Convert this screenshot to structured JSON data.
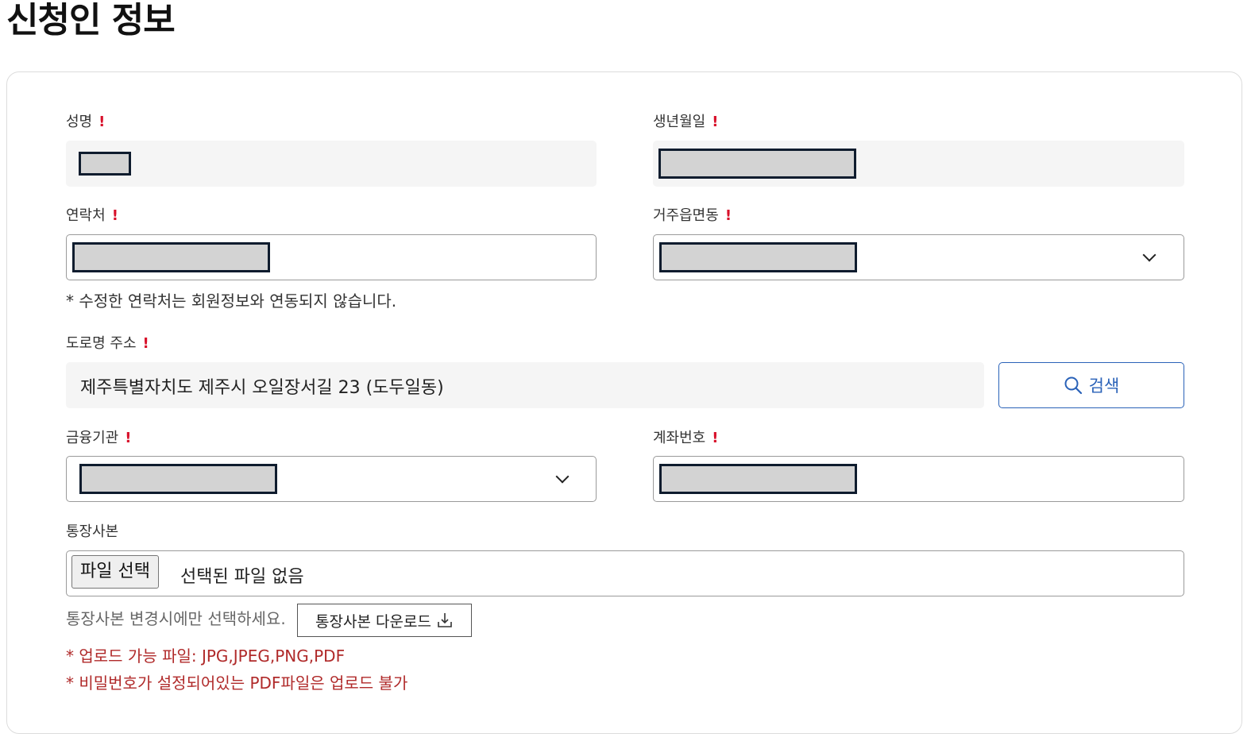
{
  "page": {
    "title": "신청인 정보"
  },
  "form": {
    "name": {
      "label": "성명",
      "required_mark": "!"
    },
    "birthdate": {
      "label": "생년월일",
      "required_mark": "!"
    },
    "contact": {
      "label": "연락처",
      "required_mark": "!",
      "note": "* 수정한 연락처는 회원정보와 연동되지 않습니다."
    },
    "district": {
      "label": "거주읍면동",
      "required_mark": "!",
      "icon": "chevron-down-icon"
    },
    "road_address": {
      "label": "도로명 주소",
      "required_mark": "!",
      "value": "제주특별자치도 제주시 오일장서길 23 (도두일동)",
      "search_button_label": "검색",
      "search_icon": "search-icon"
    },
    "bank": {
      "label": "금융기관",
      "required_mark": "!",
      "icon": "chevron-down-icon"
    },
    "account_number": {
      "label": "계좌번호",
      "required_mark": "!"
    },
    "bankbook": {
      "label": "통장사본",
      "file_button_label": "파일 선택",
      "file_status": "선택된 파일 없음",
      "hint": "통장사본 변경시에만 선택하세요.",
      "download_button_label": "통장사본 다운로드",
      "download_icon": "download-icon",
      "notes": [
        "* 업로드 가능 파일: JPG,JPEG,PNG,PDF",
        "* 비밀번호가 설정되어있는 PDF파일은 업로드 불가"
      ]
    }
  },
  "colors": {
    "required": "#d8102a",
    "accent_blue": "#2a62b8",
    "warning_text": "#b02a2a",
    "readonly_bg": "#f5f5f5",
    "redaction_fill": "#d3d3d3",
    "redaction_border": "#0f1c2e"
  }
}
